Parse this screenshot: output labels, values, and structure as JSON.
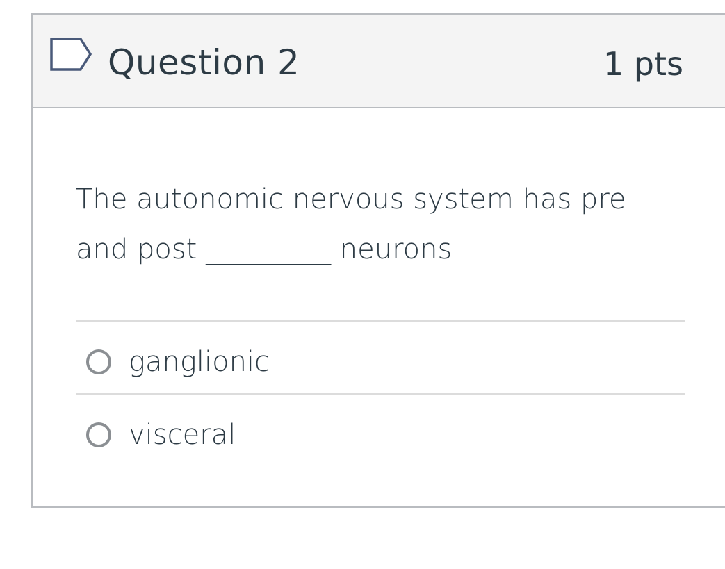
{
  "question": {
    "title": "Question 2",
    "points": "1 pts",
    "flag_icon": "bookmark-flag-icon",
    "text_line_1": "The autonomic nervous system has pre",
    "text_line_2": "and post _________ neurons"
  },
  "answers": [
    {
      "label": "ganglionic",
      "selected": false
    },
    {
      "label": "visceral",
      "selected": false
    }
  ],
  "colors": {
    "header_bg": "#f4f4f4",
    "border": "#b9bcc0",
    "text": "#2d3b45",
    "radio_border": "#8b8f93",
    "flag_stroke": "#4a5a7a"
  }
}
